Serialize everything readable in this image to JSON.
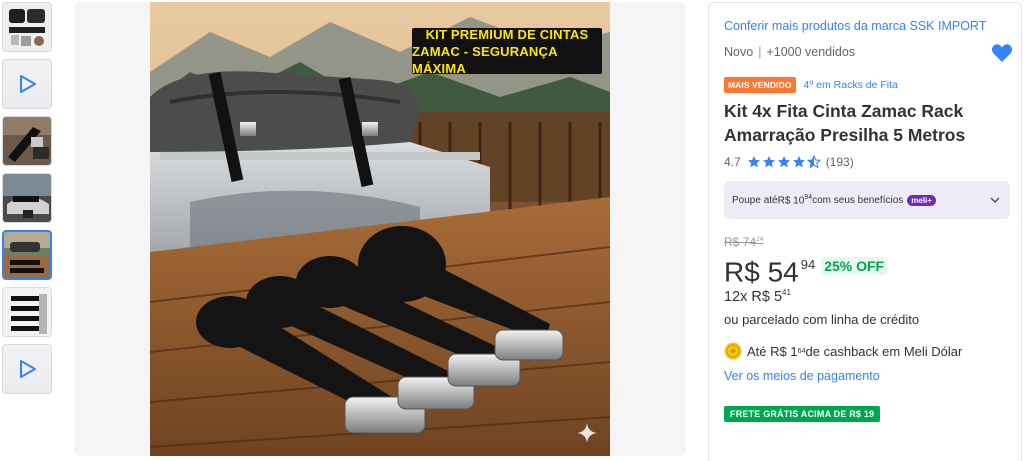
{
  "thumbnails": [
    {
      "name": "thumb-straps-pack",
      "kind": "image",
      "active": false
    },
    {
      "name": "thumb-video-1",
      "kind": "video",
      "active": false
    },
    {
      "name": "thumb-strap-buckle",
      "kind": "image",
      "active": false
    },
    {
      "name": "thumb-car-rack",
      "kind": "image",
      "active": false
    },
    {
      "name": "thumb-straps-roof",
      "kind": "image",
      "active": true
    },
    {
      "name": "thumb-straps-lined",
      "kind": "image",
      "active": false
    },
    {
      "name": "thumb-video-2",
      "kind": "video",
      "active": false
    }
  ],
  "gallery": {
    "banner_line1": "KIT PREMIUM DE CINTAS",
    "banner_line2": "ZAMAC - SEGURANÇA MÁXIMA"
  },
  "product": {
    "brand_link": "Conferir mais produtos da marca SSK IMPORT",
    "condition": "Novo",
    "sold": "+1000 vendidos",
    "best_seller_badge": "MAIS VENDIDO",
    "ranking": "4º em Racks de Fita",
    "title": "Kit 4x Fita Cinta Zamac Rack Amarração Presilha 5 Metros",
    "rating_value": "4.7",
    "rating_count": "(193)",
    "stars": 4.7
  },
  "promo": {
    "text_before": "Poupe até ",
    "amount_main": "R$ 10",
    "amount_cents": "94",
    "text_after": " com seus benefícios",
    "badge": "meli+"
  },
  "pricing": {
    "old_main": "R$ 74",
    "old_cents": "24",
    "price_main": "R$ 54",
    "price_cents": "94",
    "discount": "25% OFF",
    "installments_main": "12x R$ 5",
    "installments_cents": "41",
    "credit_text": "ou parcelado com linha de crédito",
    "cashback_before": "Até R$ 1",
    "cashback_cents": "64",
    "cashback_after": " de cashback em Meli Dólar",
    "payment_link": "Ver os meios de pagamento",
    "shipping_badge": "FRETE GRÁTIS ACIMA DE R$ 19"
  },
  "colors": {
    "link_blue": "#3483fa",
    "best_seller_orange": "#ff7733",
    "green": "#00a650",
    "promo_bg": "#f0ecf7"
  }
}
